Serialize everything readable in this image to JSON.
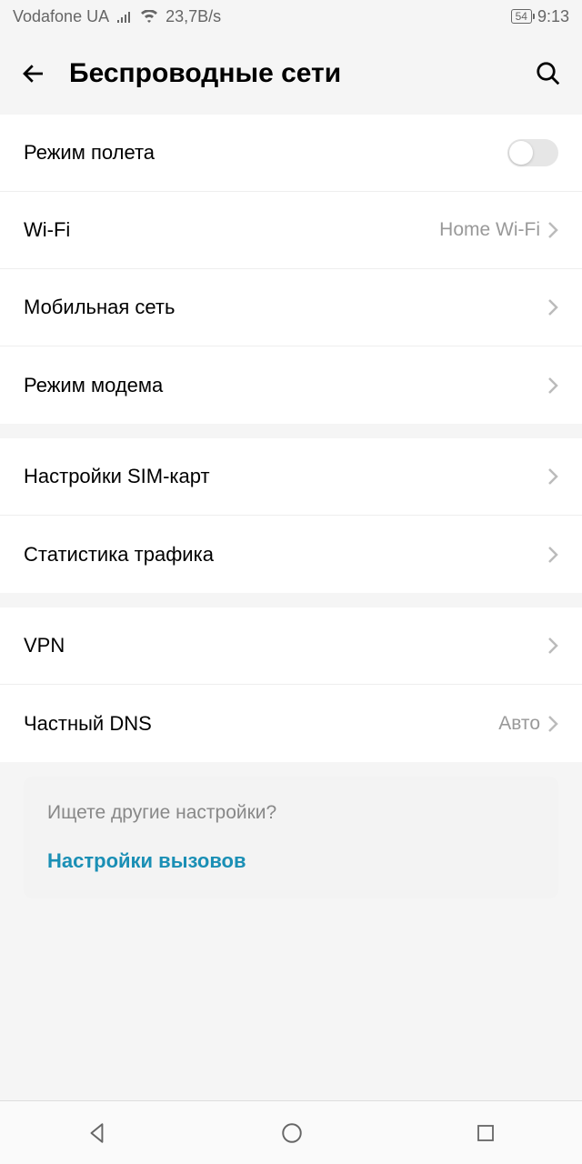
{
  "status": {
    "carrier": "Vodafone UA",
    "data_rate": "23,7B/s",
    "battery": "54",
    "time": "9:13"
  },
  "header": {
    "title": "Беспроводные сети"
  },
  "groups": [
    {
      "rows": [
        {
          "label": "Режим полета",
          "type": "toggle"
        },
        {
          "label": "Wi-Fi",
          "value": "Home Wi-Fi",
          "type": "nav"
        },
        {
          "label": "Мобильная сеть",
          "type": "nav"
        },
        {
          "label": "Режим модема",
          "type": "nav"
        }
      ]
    },
    {
      "rows": [
        {
          "label": "Настройки SIM-карт",
          "type": "nav"
        },
        {
          "label": "Статистика трафика",
          "type": "nav"
        }
      ]
    },
    {
      "rows": [
        {
          "label": "VPN",
          "type": "nav"
        },
        {
          "label": "Частный DNS",
          "value": "Авто",
          "type": "nav"
        }
      ]
    }
  ],
  "hint": {
    "title": "Ищете другие настройки?",
    "link": "Настройки вызовов"
  }
}
